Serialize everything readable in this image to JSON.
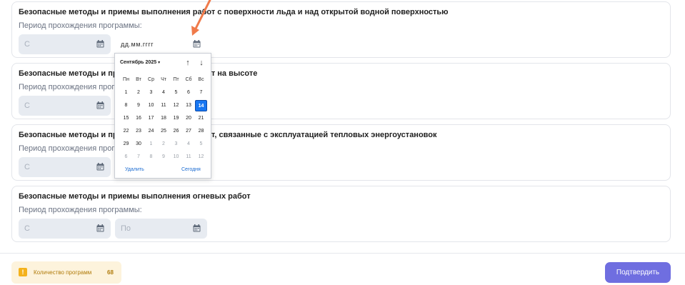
{
  "programs": [
    {
      "title": "Безопасные методы и приемы выполнения работ с поверхности льда и над открытой водной поверхностью",
      "period_label": "Период прохождения программы:",
      "from_placeholder": "С",
      "to_placeholder": "дд.мм.гггг"
    },
    {
      "title": "Безопасные методы и приемы выполнения работ на высоте",
      "period_label": "Период прохождения программы:",
      "from_placeholder": "С"
    },
    {
      "title": "Безопасные методы и приемы выполнения работ, связанные с эксплуатацией тепловых энергоустановок",
      "period_label": "Период прохождения программы:",
      "from_placeholder": "С"
    },
    {
      "title": "Безопасные методы и приемы выполнения огневых работ",
      "period_label": "Период прохождения программы:",
      "from_placeholder": "С",
      "to_placeholder": "По"
    }
  ],
  "datepicker": {
    "month_label": "Сентябрь 2025",
    "caret": "▾",
    "nav_up": "↑",
    "nav_down": "↓",
    "weekdays": [
      "Пн",
      "Вт",
      "Ср",
      "Чт",
      "Пт",
      "Сб",
      "Вс"
    ],
    "weeks": [
      [
        "1",
        "2",
        "3",
        "4",
        "5",
        "6",
        "7"
      ],
      [
        "8",
        "9",
        "10",
        "11",
        "12",
        "13",
        "14"
      ],
      [
        "15",
        "16",
        "17",
        "18",
        "19",
        "20",
        "21"
      ],
      [
        "22",
        "23",
        "24",
        "25",
        "26",
        "27",
        "28"
      ],
      [
        "29",
        "30",
        "1",
        "2",
        "3",
        "4",
        "5"
      ],
      [
        "6",
        "7",
        "8",
        "9",
        "10",
        "11",
        "12"
      ]
    ],
    "selected_day": "14",
    "delete_label": "Удалить",
    "today_label": "Сегодня"
  },
  "footer": {
    "warning_icon": "!",
    "count_label": "Количество программ",
    "count_value": "68",
    "confirm_label": "Подтвердить"
  },
  "colors": {
    "accent": "#6f6ee0",
    "selected_day": "#1877f2",
    "annotation_arrow": "#f07a4a",
    "warning": "#f4b21c"
  }
}
